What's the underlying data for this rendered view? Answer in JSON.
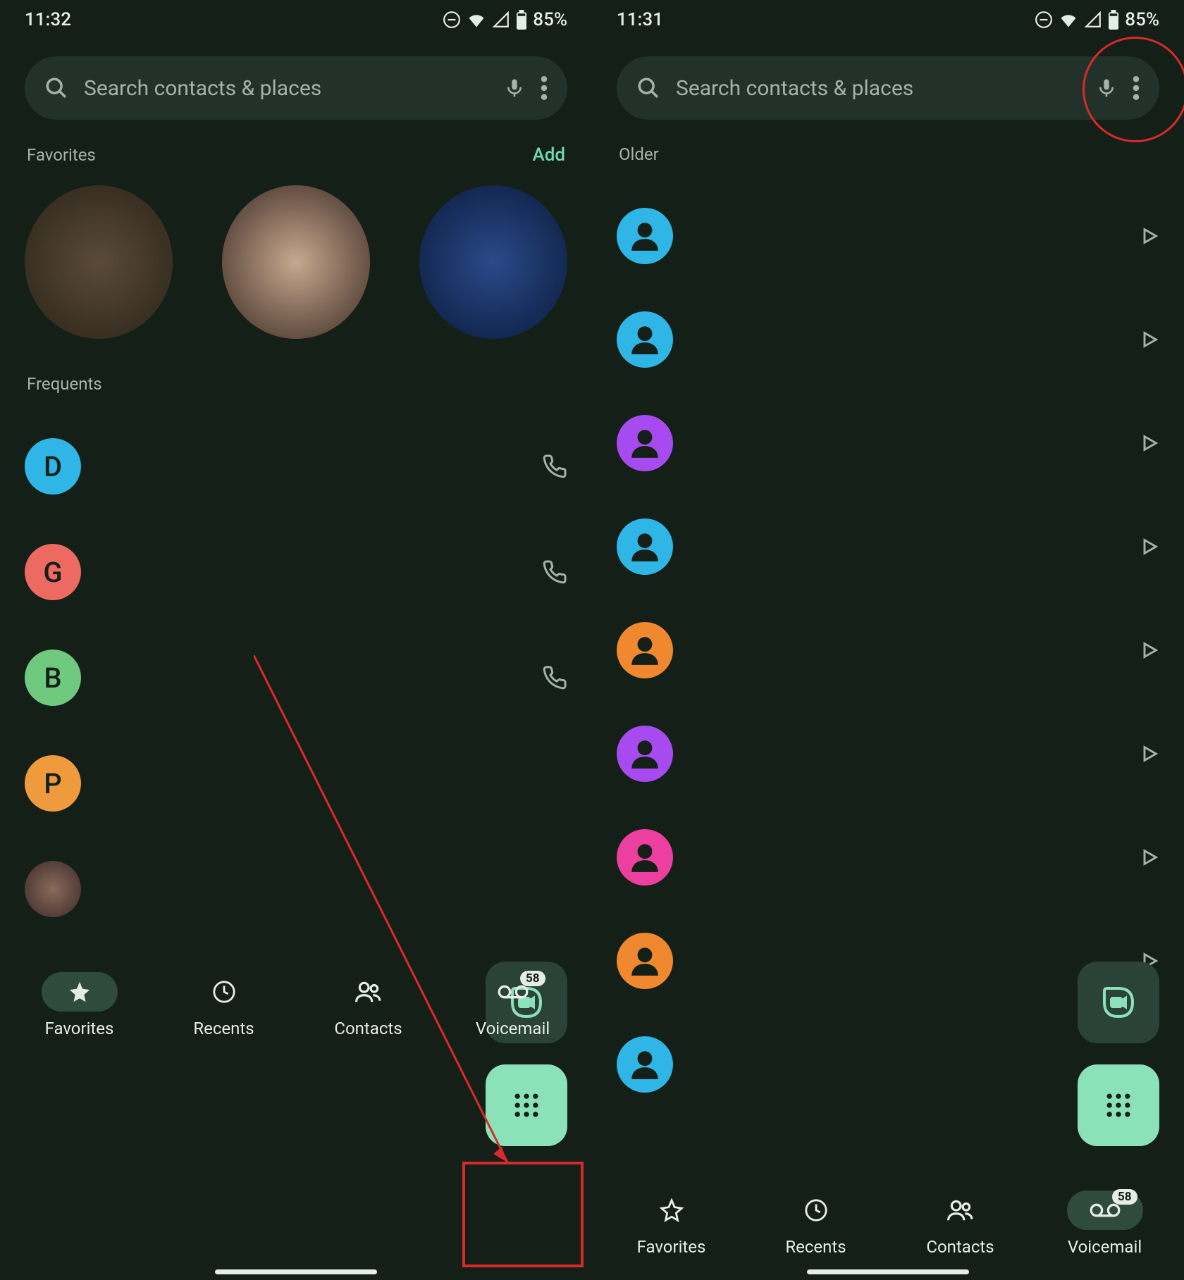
{
  "left": {
    "status": {
      "time": "11:32",
      "battery": "85%"
    },
    "search": {
      "placeholder": "Search contacts & places"
    },
    "favorites": {
      "label": "Favorites",
      "add": "Add"
    },
    "frequents": {
      "label": "Frequents",
      "items": [
        {
          "letter": "D",
          "color": "#2fb6e6"
        },
        {
          "letter": "G",
          "color": "#ec6a61"
        },
        {
          "letter": "B",
          "color": "#6fc97f"
        },
        {
          "letter": "P",
          "color": "#f09a3e"
        },
        {
          "letter": "",
          "color": "#556"
        }
      ]
    },
    "nav": {
      "favorites": "Favorites",
      "recents": "Recents",
      "contacts": "Contacts",
      "voicemail": "Voicemail",
      "vm_badge": "58"
    }
  },
  "right": {
    "status": {
      "time": "11:31",
      "battery": "85%"
    },
    "search": {
      "placeholder": "Search contacts & places"
    },
    "older": "Older",
    "voicemails": [
      {
        "color": "#2fb6e6"
      },
      {
        "color": "#2fb6e6"
      },
      {
        "color": "#a74af0"
      },
      {
        "color": "#2fb6e6"
      },
      {
        "color": "#f0882f"
      },
      {
        "color": "#a74af0"
      },
      {
        "color": "#ed3fa0"
      },
      {
        "color": "#f0882f"
      },
      {
        "color": "#2fb6e6"
      }
    ],
    "nav": {
      "favorites": "Favorites",
      "recents": "Recents",
      "contacts": "Contacts",
      "voicemail": "Voicemail",
      "vm_badge": "58"
    }
  }
}
